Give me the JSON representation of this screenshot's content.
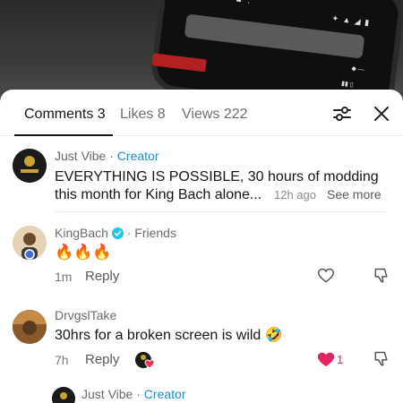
{
  "video": {
    "status_left": "",
    "status_right": "",
    "phone_bar_text": "",
    "explore_text": "",
    "bottom_text": ""
  },
  "tabs": {
    "comments": "Comments 3",
    "likes": "Likes 8",
    "views": "Views 222"
  },
  "icons": {
    "filter": "filter-sliders-icon",
    "close": "close-icon",
    "verified": "verified-badge-icon",
    "heart": "heart-icon",
    "dislike": "dislike-icon"
  },
  "comments": [
    {
      "username": "Just Vibe",
      "separator": " · ",
      "role": "Creator",
      "text_line1": "EVERYTHING IS POSSIBLE, 30 hours of modding",
      "text_line2": "this month for King Bach alone",
      "ellipsis": "...",
      "time": "12h ago",
      "see_more": "See more"
    },
    {
      "username": "KingBach",
      "separator": " · ",
      "role": "Friends",
      "text": "🔥🔥🔥",
      "time": "1m",
      "reply": "Reply"
    },
    {
      "username": "DrvgslTake",
      "text": "30hrs for a broken screen is wild 🤣",
      "time": "7h",
      "reply": "Reply",
      "like_count": "1"
    },
    {
      "username": "Just Vibe",
      "separator": " · ",
      "role": "Creator"
    }
  ],
  "colors": {
    "creator_blue": "#1f8ecb",
    "like_red": "#e0245e",
    "text": "#161616",
    "muted": "#6b6b6b"
  }
}
